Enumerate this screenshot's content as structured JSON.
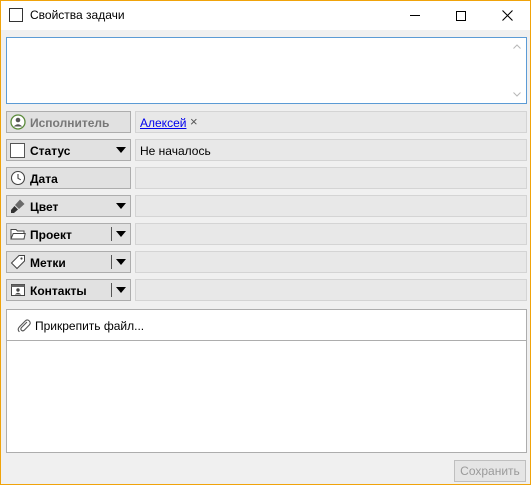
{
  "window": {
    "title": "Свойства задачи"
  },
  "fields": {
    "assignee": {
      "label": "Исполнитель",
      "value": "Алексей",
      "remove": "×"
    },
    "status": {
      "label": "Статус",
      "value": "Не началось"
    },
    "date": {
      "label": "Дата",
      "value": ""
    },
    "color": {
      "label": "Цвет",
      "value": ""
    },
    "project": {
      "label": "Проект",
      "value": ""
    },
    "tags": {
      "label": "Метки",
      "value": ""
    },
    "contacts": {
      "label": "Контакты",
      "value": ""
    }
  },
  "attachments": {
    "button_label": "Прикрепить файл..."
  },
  "footer": {
    "save_label": "Сохранить"
  },
  "colors": {
    "accent_border": "#f0a30a",
    "focus_border": "#5b9bd5",
    "link": "#0000ee"
  }
}
